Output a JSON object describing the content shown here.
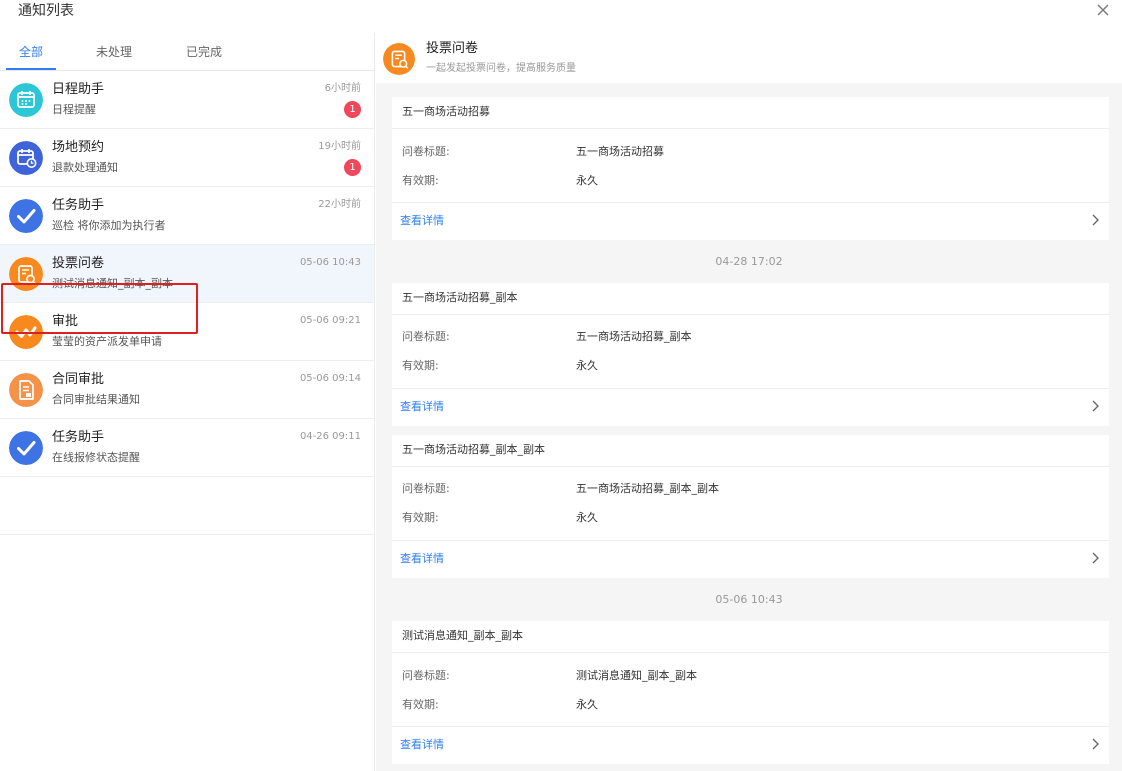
{
  "header": {
    "title": "通知列表"
  },
  "tabs": [
    {
      "label": "全部"
    },
    {
      "label": "未处理"
    },
    {
      "label": "已完成"
    }
  ],
  "list": [
    {
      "name": "日程助手",
      "sub": "日程提醒",
      "time": "6小时前",
      "badge": "1",
      "icon": "calendar-icon",
      "color": "#2cc7d6"
    },
    {
      "name": "场地预约",
      "sub": "退款处理通知",
      "time": "19小时前",
      "badge": "1",
      "icon": "calendar-clock-icon",
      "color": "#3f63d9"
    },
    {
      "name": "任务助手",
      "sub": "巡检 将你添加为执行者",
      "time": "22小时前",
      "icon": "check-icon",
      "color": "#3e73e6"
    },
    {
      "name": "投票问卷",
      "sub": "测试消息通知_副本_副本",
      "time": "05-06 10:43",
      "icon": "survey-icon",
      "color": "#f7891e"
    },
    {
      "name": "审批",
      "sub": "莹莹的资产派发单申请",
      "time": "05-06 09:21",
      "icon": "approval-icon",
      "color": "#f7891e"
    },
    {
      "name": "合同审批",
      "sub": "合同审批结果通知",
      "time": "05-06 09:14",
      "icon": "contract-icon",
      "color": "#f5924a"
    },
    {
      "name": "任务助手",
      "sub": "在线报修状态提醒",
      "time": "04-26 09:11",
      "icon": "check-icon",
      "color": "#3e73e6"
    }
  ],
  "detail": {
    "name": "投票问卷",
    "desc": "一起发起投票问卷，提高服务质量",
    "color": "#f7891e",
    "cards": [
      {
        "title": "五一商场活动招募",
        "label1": "问卷标题:",
        "value1": "五一商场活动招募",
        "label2": "有效期:",
        "value2": "永久",
        "link": "查看详情"
      },
      {
        "title": "五一商场活动招募_副本",
        "label1": "问卷标题:",
        "value1": "五一商场活动招募_副本",
        "label2": "有效期:",
        "value2": "永久",
        "link": "查看详情"
      },
      {
        "title": "五一商场活动招募_副本_副本",
        "label1": "问卷标题:",
        "value1": "五一商场活动招募_副本_副本",
        "label2": "有效期:",
        "value2": "永久",
        "link": "查看详情"
      },
      {
        "title": "测试消息通知_副本_副本",
        "label1": "问卷标题:",
        "value1": "测试消息通知_副本_副本",
        "label2": "有效期:",
        "value2": "永久",
        "link": "查看详情"
      }
    ],
    "stamps": [
      "04-28 17:02",
      "05-06 10:43"
    ]
  },
  "colors": {
    "accent": "#2f7ff2",
    "badge": "#f0475a",
    "highlight": "#e02020"
  }
}
